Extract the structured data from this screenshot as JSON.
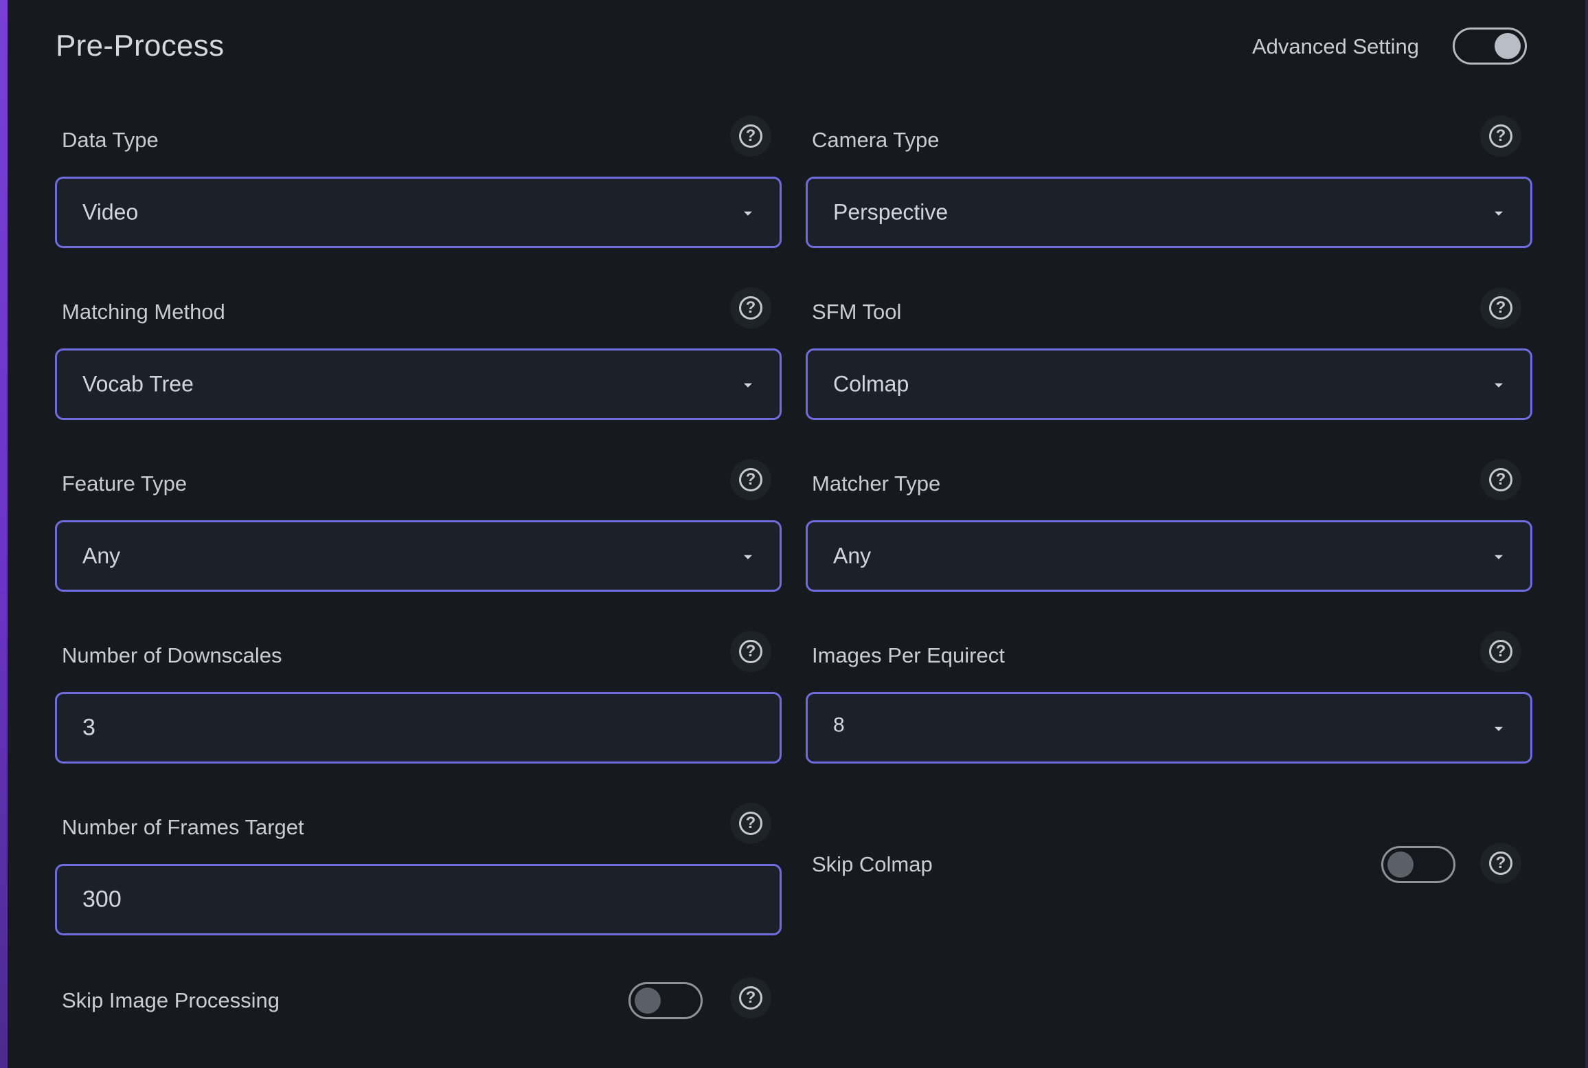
{
  "header": {
    "title": "Pre-Process",
    "advanced_label": "Advanced Setting",
    "advanced_on": true
  },
  "fields": {
    "data_type": {
      "label": "Data Type",
      "value": "Video"
    },
    "camera_type": {
      "label": "Camera Type",
      "value": "Perspective"
    },
    "matching_method": {
      "label": "Matching Method",
      "value": "Vocab Tree"
    },
    "sfm_tool": {
      "label": "SFM Tool",
      "value": "Colmap"
    },
    "feature_type": {
      "label": "Feature Type",
      "value": "Any"
    },
    "matcher_type": {
      "label": "Matcher Type",
      "value": "Any"
    },
    "num_downscales": {
      "label": "Number of Downscales",
      "value": "3"
    },
    "images_per_equirect": {
      "label": "Images Per Equirect",
      "value": "8"
    },
    "num_frames_target": {
      "label": "Number of Frames Target",
      "value": "300"
    }
  },
  "toggles": {
    "skip_colmap": {
      "label": "Skip Colmap",
      "on": false
    },
    "skip_image_processing": {
      "label": "Skip Image Processing",
      "on": false
    }
  },
  "help_glyph": "?",
  "icons": {
    "help": "help-circle-icon",
    "dropdown": "caret-down-icon"
  },
  "colors": {
    "background": "#16191e",
    "field_border": "#6f6ce0",
    "field_fill": "#1c2029",
    "accent_edge": "#7a3fd6"
  }
}
